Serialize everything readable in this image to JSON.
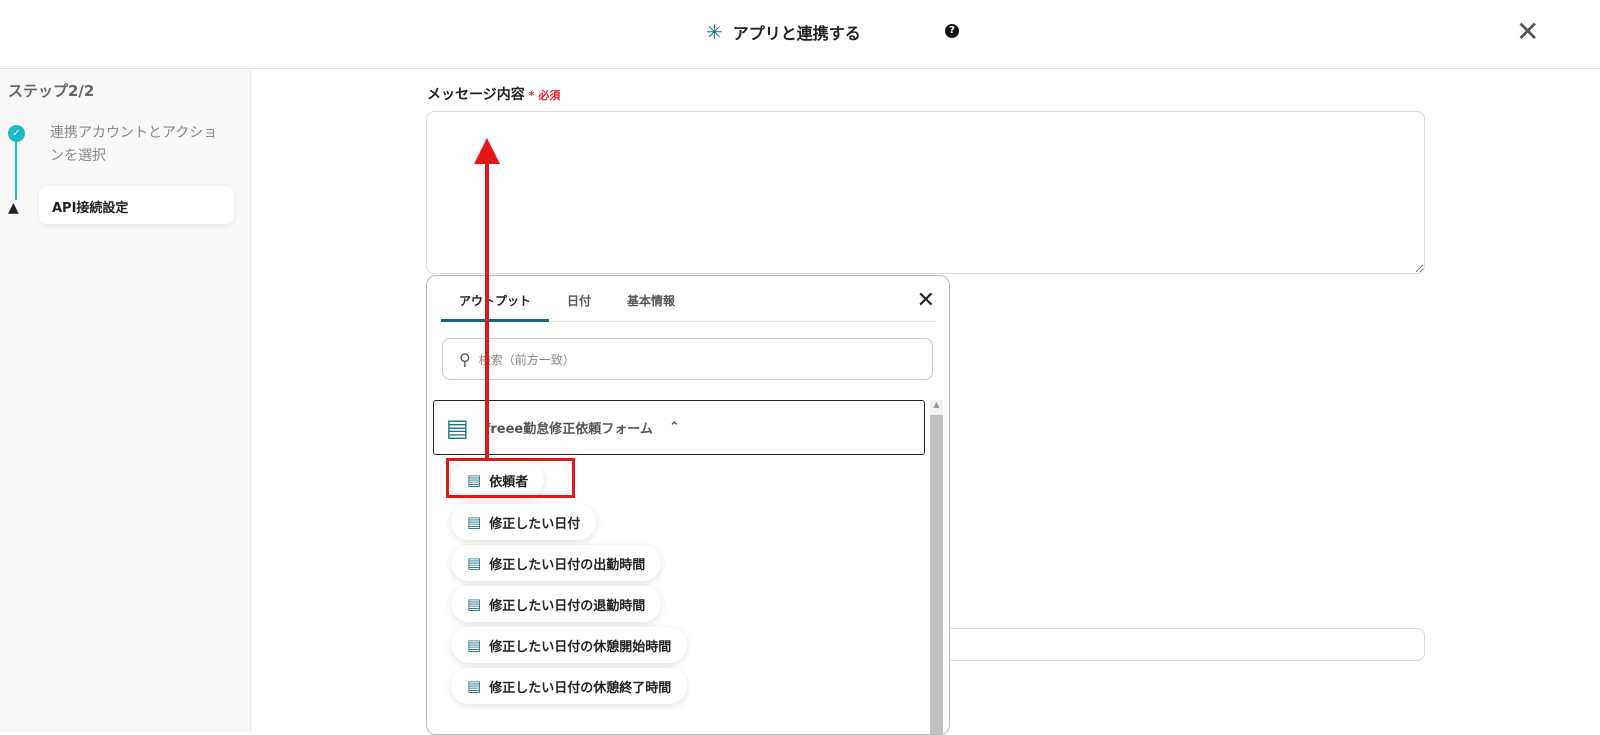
{
  "header": {
    "title": "アプリと連携する",
    "help": "?",
    "close": "✕"
  },
  "sidebar": {
    "step_heading": "ステップ2/2",
    "steps": [
      {
        "label": "連携アカウントとアクションを選択",
        "status": "done"
      },
      {
        "label": "API接続設定",
        "status": "warning"
      }
    ]
  },
  "form": {
    "message_label": "メッセージ内容",
    "required_mark": "*",
    "required_text": "必須"
  },
  "popup": {
    "tabs": [
      "アウトプット",
      "日付",
      "基本情報"
    ],
    "search_placeholder": "検索（前方一致）",
    "group_title": "freee勤怠修正依頼フォーム",
    "items": [
      "依頼者",
      "修正したい日付",
      "修正したい日付の出勤時間",
      "修正したい日付の退勤時間",
      "修正したい日付の休憩開始時間",
      "修正したい日付の休憩終了時間"
    ]
  },
  "colors": {
    "accent": "#146a80",
    "annotation": "#e51616",
    "step_done": "#1fb8c8"
  }
}
